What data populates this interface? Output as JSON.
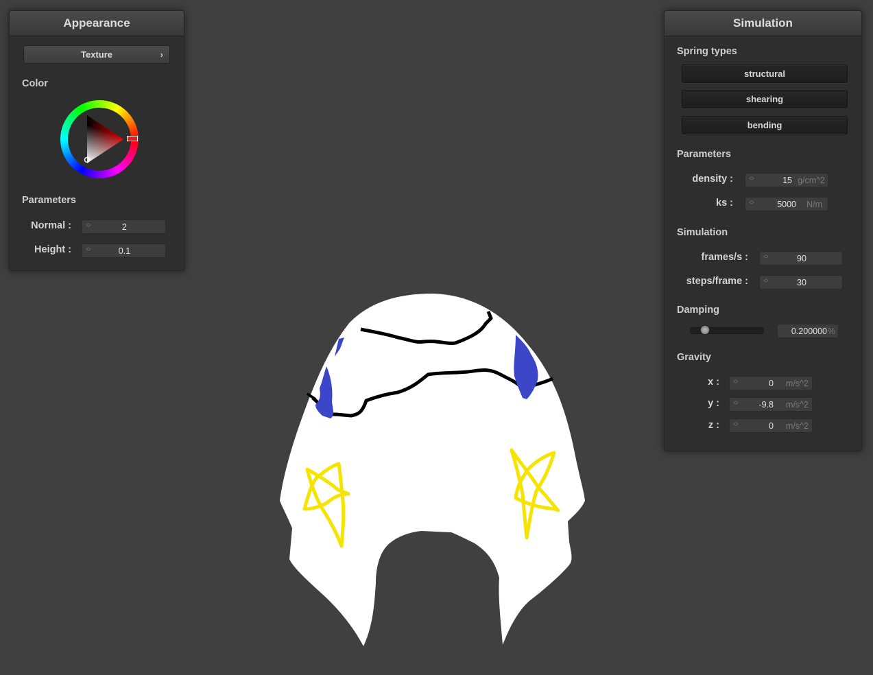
{
  "appearance": {
    "title": "Appearance",
    "texture_button": "Texture",
    "color_label": "Color",
    "color_value": "#d42a2a",
    "params_label": "Parameters",
    "normal": {
      "label": "Normal :",
      "value": "2"
    },
    "height": {
      "label": "Height :",
      "value": "0.1"
    }
  },
  "simulation": {
    "title": "Simulation",
    "spring_types_label": "Spring types",
    "spring_buttons": [
      "structural",
      "shearing",
      "bending"
    ],
    "params_label": "Parameters",
    "density": {
      "label": "density :",
      "value": "15",
      "unit": "g/cm^2"
    },
    "ks": {
      "label": "ks :",
      "value": "5000",
      "unit": "N/m"
    },
    "sim_label": "Simulation",
    "fps": {
      "label": "frames/s :",
      "value": "90"
    },
    "steps": {
      "label": "steps/frame :",
      "value": "30"
    },
    "damping_label": "Damping",
    "damping": {
      "value": "0.200000",
      "unit": "%",
      "slider_fraction": 0.2
    },
    "gravity_label": "Gravity",
    "gravity": {
      "x": {
        "label": "x :",
        "value": "0",
        "unit": "m/s^2"
      },
      "y": {
        "label": "y :",
        "value": "-9.8",
        "unit": "m/s^2"
      },
      "z": {
        "label": "z :",
        "value": "0",
        "unit": "m/s^2"
      }
    }
  },
  "scene": {
    "background": "#404040",
    "cloth_color": "#ffffff",
    "stroke_colors": {
      "lines": "#000000",
      "blue": "#3b46c9",
      "stars": "#f5e400"
    }
  }
}
